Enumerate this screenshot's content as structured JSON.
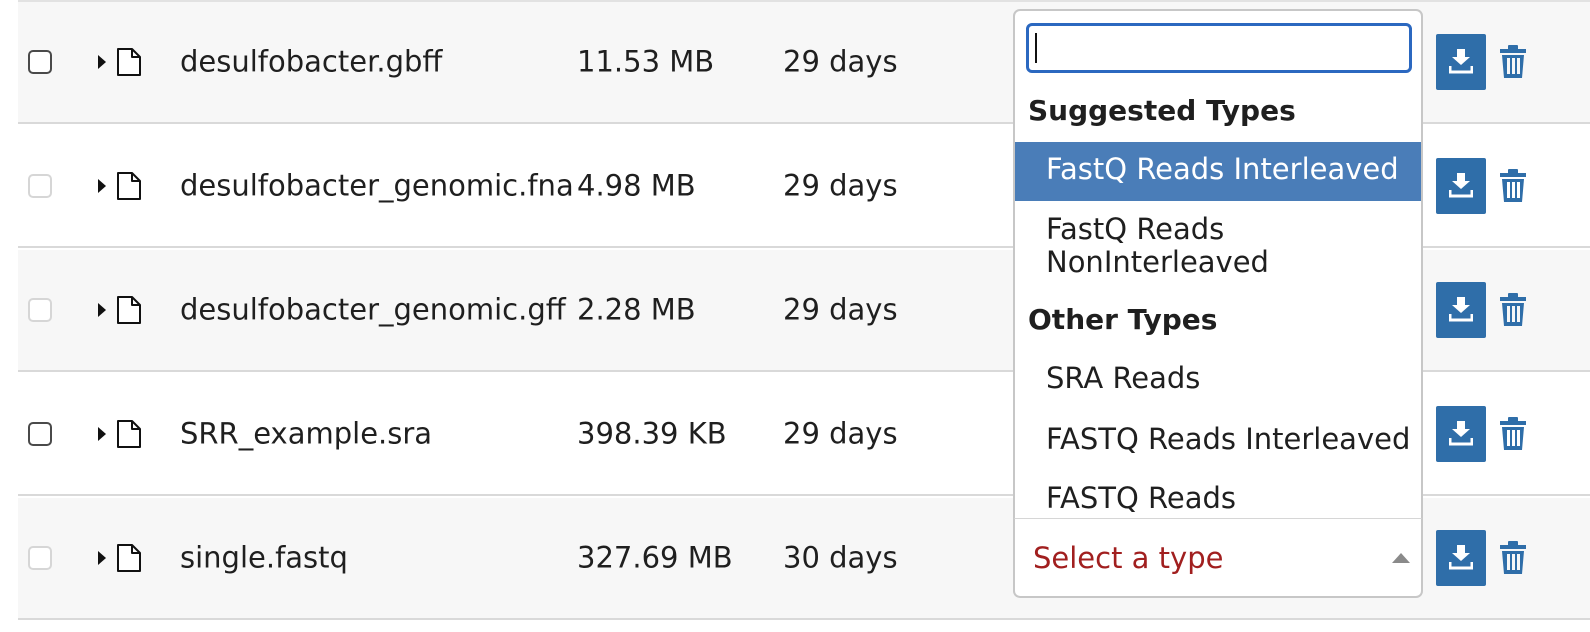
{
  "files": [
    {
      "name": "desulfobacter.gbff",
      "size": "11.53 MB",
      "date": "29 days",
      "checkbox_enabled": true
    },
    {
      "name": "desulfobacter_genomic.fna",
      "size": "4.98 MB",
      "date": "29 days",
      "checkbox_enabled": false
    },
    {
      "name": "desulfobacter_genomic.gff",
      "size": "2.28 MB",
      "date": "29 days",
      "checkbox_enabled": false
    },
    {
      "name": "SRR_example.sra",
      "size": "398.39 KB",
      "date": "29 days",
      "checkbox_enabled": true
    },
    {
      "name": "single.fastq",
      "size": "327.69 MB",
      "date": "30 days",
      "checkbox_enabled": false
    }
  ],
  "type_select": {
    "placeholder": "Select a type",
    "search_value": "",
    "groups": [
      {
        "label": "Suggested Types",
        "options": [
          "FastQ Reads Interleaved",
          "FastQ Reads NonInterleaved"
        ]
      },
      {
        "label": "Other Types",
        "options": [
          "SRA Reads",
          "FASTQ Reads Interleaved",
          "FASTQ Reads"
        ]
      }
    ],
    "highlighted_option": "FastQ Reads Interleaved"
  },
  "icons": {
    "expand": "caret-right-icon",
    "file": "file-icon",
    "download": "download-icon",
    "delete": "trash-icon",
    "select_arrow": "caret-up-icon"
  },
  "colors": {
    "action_blue": "#2f6ea9",
    "highlight": "#4a7db8",
    "placeholder_red": "#a11f1f",
    "focus_border": "#2b68c0"
  }
}
